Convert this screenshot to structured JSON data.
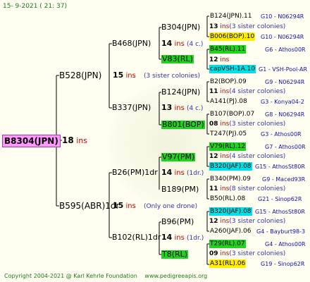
{
  "header": {
    "date": "15-  9-2021 (  21: 37)"
  },
  "footer": {
    "copyright": "Copyright 2004-2021 @ Karl Kehrle Foundation",
    "site": "www.pedigreeapis.org"
  },
  "root": {
    "label": "B8304(JPN)",
    "ins_num": "18",
    "ins_word": "ins"
  },
  "gen1": {
    "top": {
      "label": "B528(JPN)",
      "ins_num": "15",
      "ins_word": "ins",
      "info": "(3 sister colonies)"
    },
    "bottom": {
      "label": "B595(ABR)1dr",
      "ins_num": "15",
      "ins_word": "ins",
      "info": "(Only one drone)"
    }
  },
  "gen2": {
    "a": {
      "label": "B468(JPN)",
      "ins_num": "14",
      "ins_word": "ins",
      "info": "(4 c.)"
    },
    "b": {
      "label": "B337(JPN)",
      "ins_num": "13",
      "ins_word": "ins",
      "info": "(4 c.)"
    },
    "c": {
      "label": "B26(PM)1dr",
      "ins_num": "14",
      "ins_word": "ins",
      "info": "(1dr.)"
    },
    "d": {
      "label": "B102(RL)1dr",
      "ins_num": "14",
      "ins_word": "ins",
      "info": "(1dr.)"
    }
  },
  "gen3": {
    "a1": {
      "label": "B304(JPN)",
      "ins_num": "14",
      "ins_word": "ins",
      "info": "(4 c.)"
    },
    "a2": {
      "label": "V83(RL)"
    },
    "b1": {
      "label": "B124(JPN)",
      "ins_num": "13",
      "ins_word": "ins",
      "info": "(4 c.)"
    },
    "b2": {
      "label": "B801(BOP)"
    },
    "c1": {
      "label": "V97(PM)"
    },
    "c2": {
      "label": "B189(PM)",
      "ins_num": "14",
      "ins_word": "ins",
      "info": "(1dr.)"
    },
    "d1": {
      "label": "B96(PM)",
      "ins_num": "14",
      "ins_word": "ins",
      "info": "(1dr.)"
    },
    "d2": {
      "label": "T8(RL)"
    }
  },
  "gen4": [
    {
      "label": "B124(JPN).11",
      "code": "G10 - N06294R"
    },
    {
      "ins_num": "13",
      "ins_word": "ins",
      "info": "(3 sister colonies)"
    },
    {
      "label": "B006(BOP).10",
      "code": "G10 - N06294R"
    },
    {
      "label": "B45(RL).11",
      "code": "G6 - Athos00R"
    },
    {
      "ins_num": "12",
      "ins_word": "ins"
    },
    {
      "label": "capVSH-1A.10",
      "code": "G1 - VSH-Pool-AR"
    },
    {
      "label": "B2(BOP).09",
      "code": "G9 - N06294R"
    },
    {
      "ins_num": "11",
      "ins_word": "ins",
      "info": "(4 sister colonies)"
    },
    {
      "label": "A141(PJ).08",
      "code": "G3 - Konya04-2"
    },
    {
      "label": "B107(BOP).07",
      "code": "G8 - N06294R"
    },
    {
      "ins_num": "08",
      "ins_word": "ins",
      "info": "(3 sister colonies)"
    },
    {
      "label": "T247(PJ).05",
      "code": "G3 - Athos00R"
    },
    {
      "label": "V79(RL).12",
      "code": "G7 - Athos00R"
    },
    {
      "ins_num": "12",
      "ins_word": "ins",
      "info": "(4 sister colonies)"
    },
    {
      "label": "B320(JAF).08",
      "code": "G15 - AthosSt80R"
    },
    {
      "label": "B340(PM).09",
      "code": "G9 - Maced93R"
    },
    {
      "ins_num": "11",
      "ins_word": "ins",
      "info": "(8 sister colonies)"
    },
    {
      "label": "B50(RL).08",
      "code": "G21 - Sinop62R"
    },
    {
      "label": "B320(JAF).08",
      "code": "G15 - AthosSt80R"
    },
    {
      "ins_num": "12",
      "ins_word": "ins",
      "info": "(3 sister colonies)"
    },
    {
      "label": "A260(JAF).06",
      "code": "G4 - Bayburt98-3"
    },
    {
      "label": "T29(RL).07",
      "code": "G4 - Athos00R"
    },
    {
      "ins_num": "09",
      "ins_word": "ins",
      "info": "(3 sister colonies)"
    },
    {
      "label": "A31(RL).06",
      "code": "G19 - Sinop62R"
    }
  ]
}
